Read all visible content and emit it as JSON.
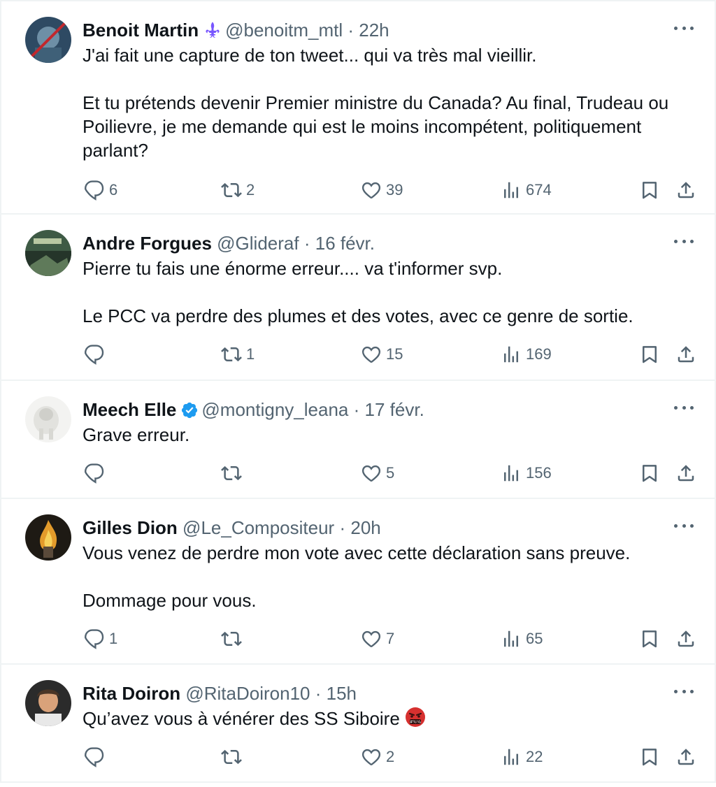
{
  "tweets": [
    {
      "name": "Benoit Martin",
      "handle": "@benoitm_mtl",
      "dot": "·",
      "time": "22h",
      "badge": "fleur-de-lis",
      "paragraphs": [
        "J'ai fait une capture de ton tweet... qui va très mal vieillir.",
        "Et tu prétends devenir Premier ministre du Canada? Au final, Trudeau ou Poilievre, je me demande qui est le moins incompétent, politiquement parlant?"
      ],
      "replies": "6",
      "retweets": "2",
      "likes": "39",
      "views": "674"
    },
    {
      "name": "Andre Forgues",
      "handle": "@Glideraf",
      "dot": "·",
      "time": "16 févr.",
      "paragraphs": [
        "Pierre tu fais une énorme erreur.... va t'informer svp.",
        "Le PCC va perdre des plumes et des votes, avec ce genre de sortie."
      ],
      "replies": "",
      "retweets": "1",
      "likes": "15",
      "views": "169"
    },
    {
      "name": "Meech Elle",
      "handle": "@montigny_leana",
      "dot": "·",
      "time": "17 févr.",
      "badge": "verified",
      "paragraphs": [
        "Grave erreur."
      ],
      "replies": "",
      "retweets": "",
      "likes": "5",
      "views": "156"
    },
    {
      "name": "Gilles Dion",
      "handle": "@Le_Compositeur",
      "dot": "·",
      "time": "20h",
      "paragraphs": [
        "Vous venez de perdre mon vote avec cette déclaration sans preuve.",
        "Dommage pour vous."
      ],
      "replies": "1",
      "retweets": "",
      "likes": "7",
      "views": "65"
    },
    {
      "name": "Rita Doiron",
      "handle": "@RitaDoiron10",
      "dot": "·",
      "time": "15h",
      "paragraphs": [
        "Qu’avez vous à vénérer des SS Siboire"
      ],
      "emoji": "angry-cursing-face",
      "replies": "",
      "retweets": "",
      "likes": "2",
      "views": "22"
    }
  ],
  "icons": {
    "reply": "reply-icon",
    "retweet": "retweet-icon",
    "like": "heart-icon",
    "views": "views-icon",
    "bookmark": "bookmark-icon",
    "share": "share-icon",
    "more": "more-icon"
  },
  "colors": {
    "text": "#0f1419",
    "secondary": "#536471",
    "verified": "#1d9bf0",
    "fleur": "#7856ff",
    "divider": "#eff3f4"
  }
}
